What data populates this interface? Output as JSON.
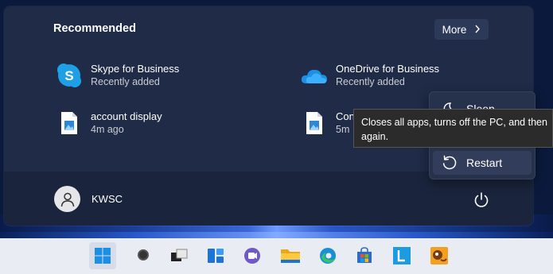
{
  "recommended": {
    "title": "Recommended",
    "more_label": "More",
    "items": [
      {
        "name": "Skype for Business",
        "sub": "Recently added",
        "icon": "skype-icon"
      },
      {
        "name": "OneDrive for Business",
        "sub": "Recently added",
        "icon": "onedrive-icon"
      },
      {
        "name": "account display",
        "sub": "4m ago",
        "icon": "image-file-icon"
      },
      {
        "name": "Con",
        "sub": "5m",
        "icon": "image-file-icon"
      }
    ]
  },
  "user": {
    "name": "KWSC"
  },
  "power_menu": {
    "items": [
      {
        "label": "Sleep",
        "icon": "moon-icon"
      },
      {
        "label": "Restart",
        "icon": "restart-icon"
      }
    ],
    "tooltip_line1": "Closes all apps, turns off the PC, and then",
    "tooltip_line2": "again."
  },
  "taskbar": {
    "icons": [
      "windows-start-icon",
      "search-icon",
      "task-view-icon",
      "widgets-icon",
      "teams-chat-icon",
      "file-explorer-icon",
      "edge-icon",
      "store-icon",
      "lync-icon",
      "game-icon"
    ]
  },
  "colors": {
    "accent": "#0078d4",
    "panel": "#1e2a45",
    "taskbar": "#e9edf3"
  }
}
